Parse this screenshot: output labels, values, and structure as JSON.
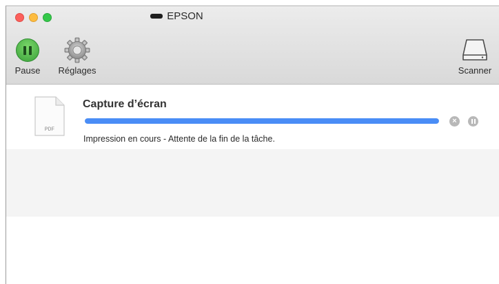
{
  "window": {
    "title": "EPSON"
  },
  "toolbar": {
    "pause_label": "Pause",
    "settings_label": "Réglages",
    "scanner_label": "Scanner"
  },
  "job": {
    "name": "Capture d’écran",
    "file_type": "PDF",
    "progress": 1.0,
    "status": "Impression en cours - Attente de la fin de la tâche."
  },
  "colors": {
    "accent": "#4a8df6",
    "close": "#fc605c",
    "minimize": "#fdbc40",
    "zoom": "#34c84a",
    "pause_green": "#3aa03a"
  },
  "icons": {
    "pause": "pause-circle-icon",
    "settings": "gear-icon",
    "scanner": "drive-icon",
    "document": "document-icon",
    "cancel": "cancel-icon",
    "hold": "hold-icon"
  }
}
